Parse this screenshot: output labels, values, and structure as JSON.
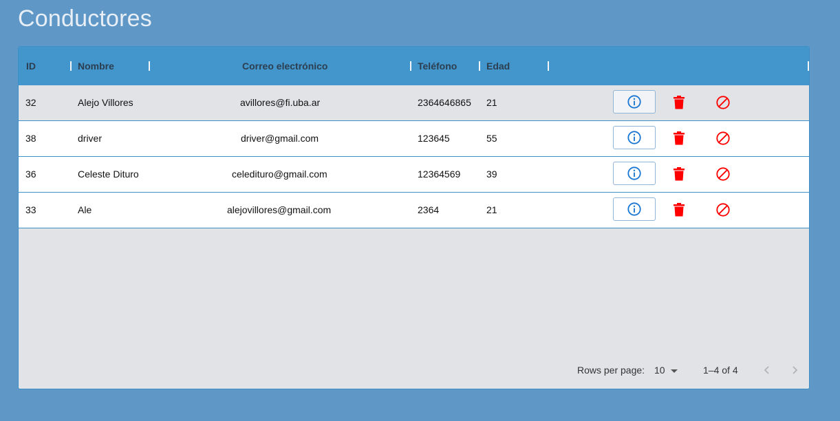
{
  "page": {
    "title": "Conductores"
  },
  "table": {
    "columns": {
      "id": "ID",
      "name": "Nombre",
      "email": "Correo electrónico",
      "phone": "Teléfono",
      "age": "Edad"
    },
    "rows": [
      {
        "id": "32",
        "name": "Alejo Villores",
        "email": "avillores@fi.uba.ar",
        "phone": "2364646865",
        "age": "21"
      },
      {
        "id": "38",
        "name": "driver",
        "email": "driver@gmail.com",
        "phone": "123645",
        "age": "55"
      },
      {
        "id": "36",
        "name": "Celeste Dituro",
        "email": "celedituro@gmail.com",
        "phone": "12364569",
        "age": "39"
      },
      {
        "id": "33",
        "name": "Ale",
        "email": "alejovillores@gmail.com",
        "phone": "2364",
        "age": "21"
      }
    ],
    "row_actions": {
      "info_icon": "info-circle-icon",
      "delete_icon": "trash-icon",
      "block_icon": "block-icon"
    }
  },
  "pagination": {
    "rows_per_page_label": "Rows per page:",
    "rows_per_page_value": "10",
    "range_text": "1–4 of 4"
  },
  "colors": {
    "background": "#5f98c6",
    "header": "#4396cb",
    "info_icon": "#1976d2",
    "danger": "#ff0000"
  }
}
